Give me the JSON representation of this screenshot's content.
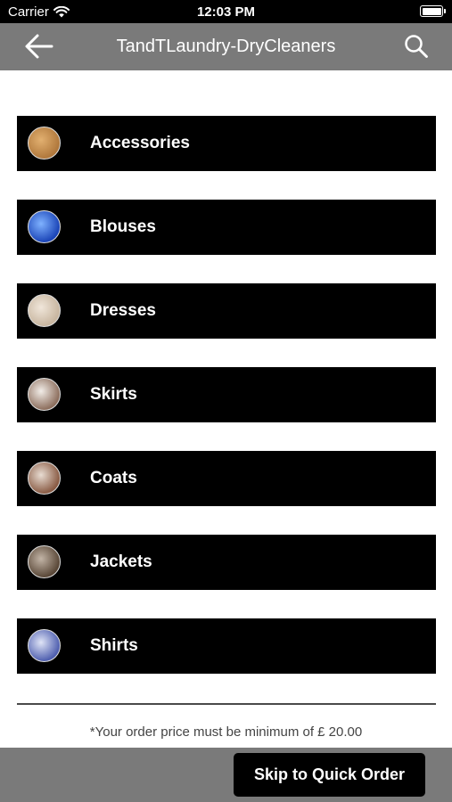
{
  "status_bar": {
    "carrier": "Carrier",
    "time": "12:03 PM"
  },
  "header": {
    "title": "TandTLaundry-DryCleaners",
    "back_icon": "arrow-left-icon",
    "search_icon": "search-icon"
  },
  "categories": [
    {
      "label": "Accessories",
      "thumb_colors": [
        "#b0783c",
        "#e2b070"
      ]
    },
    {
      "label": "Blouses",
      "thumb_colors": [
        "#1b45b8",
        "#7fb2ff"
      ]
    },
    {
      "label": "Dresses",
      "thumb_colors": [
        "#c8b6a0",
        "#f0e6da"
      ]
    },
    {
      "label": "Skirts",
      "thumb_colors": [
        "#8d6f5e",
        "#f2ede8"
      ]
    },
    {
      "label": "Coats",
      "thumb_colors": [
        "#8a5c45",
        "#e8dcd2"
      ]
    },
    {
      "label": "Jackets",
      "thumb_colors": [
        "#5a4838",
        "#c2b4a6"
      ]
    },
    {
      "label": "Shirts",
      "thumb_colors": [
        "#5060b0",
        "#dfe4f6"
      ]
    }
  ],
  "footer": {
    "min_order_note": "*Your order price must be minimum of £  20.00",
    "quick_order_label": "Skip to Quick Order"
  },
  "colors": {
    "nav_background": "#7a7a7a",
    "item_background": "#000000",
    "button_background": "#000000"
  }
}
